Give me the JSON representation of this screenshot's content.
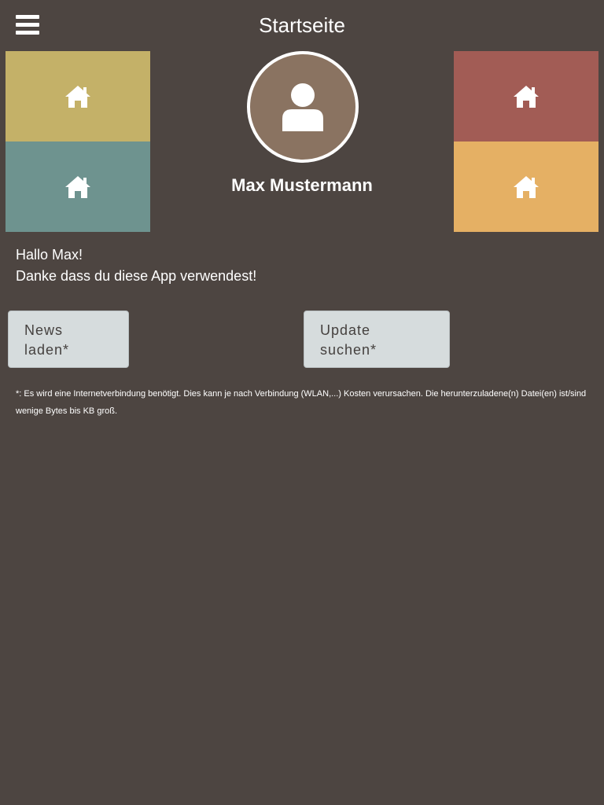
{
  "header": {
    "title": "Startseite",
    "menu_icon": "hamburger-menu-icon"
  },
  "tiles": [
    {
      "position": "top-left",
      "icon": "home-icon",
      "color": "#c4b168"
    },
    {
      "position": "bottom-left",
      "icon": "home-icon",
      "color": "#6e938f"
    },
    {
      "position": "top-right",
      "icon": "home-icon",
      "color": "#a25c55"
    },
    {
      "position": "bottom-right",
      "icon": "home-icon",
      "color": "#e5b064"
    }
  ],
  "profile": {
    "name": "Max Mustermann",
    "avatar_icon": "user-icon",
    "avatar_color": "#8a7361"
  },
  "greeting": {
    "line1": "Hallo Max!",
    "line2": "Danke dass du diese App verwendest!"
  },
  "buttons": {
    "news": {
      "line1": "News",
      "line2": "laden*"
    },
    "update": {
      "line1": "Update",
      "line2": "suchen*"
    }
  },
  "footnote": "*: Es wird eine Internetverbindung benötigt. Dies kann je nach Verbindung (WLAN,...) Kosten verursachen. Die herunterzuladene(n) Datei(en) ist/sind wenige Bytes bis KB groß.",
  "colors": {
    "background": "#4d4541",
    "button_bg": "#d6dcdd",
    "button_text": "#45413f"
  }
}
